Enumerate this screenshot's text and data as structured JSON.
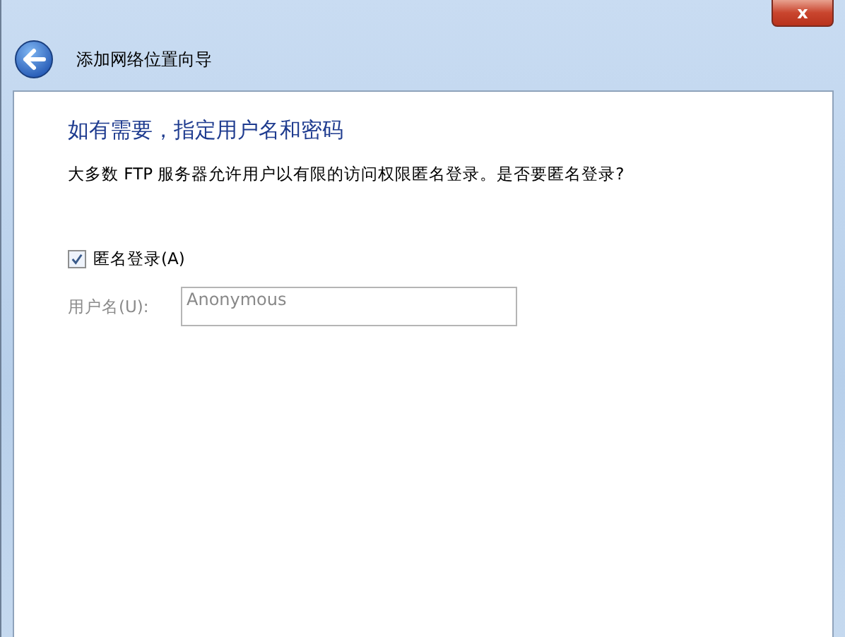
{
  "window": {
    "close": "x"
  },
  "wizard": {
    "title": "添加网络位置向导"
  },
  "page": {
    "heading": "如有需要，指定用户名和密码",
    "description": "大多数 FTP 服务器允许用户以有限的访问权限匿名登录。是否要匿名登录?",
    "anonymous": {
      "label": "匿名登录(A)",
      "checked": true
    },
    "username": {
      "label": "用户名(U):",
      "value": "Anonymous",
      "disabled": true
    }
  }
}
